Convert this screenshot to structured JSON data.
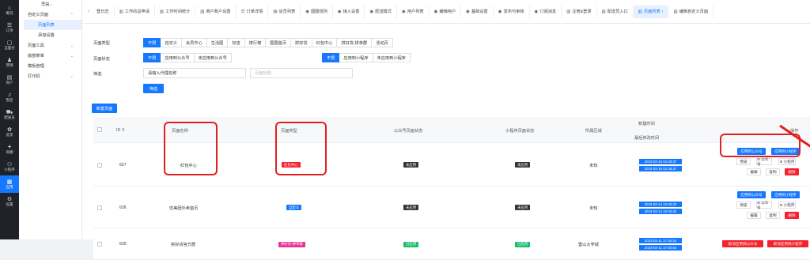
{
  "rail": [
    {
      "icon": "⌂",
      "label": "概况"
    },
    {
      "icon": "☰",
      "label": "订单"
    },
    {
      "icon": "▢",
      "label": "当面付"
    },
    {
      "icon": "♟",
      "label": "营销"
    },
    {
      "icon": "▤",
      "label": "商户"
    },
    {
      "icon": "♫",
      "label": "售后"
    },
    {
      "icon": "⛟",
      "label": "配送员"
    },
    {
      "icon": "✿",
      "label": "选货"
    },
    {
      "icon": "✦",
      "label": "商圈"
    },
    {
      "icon": "⚇",
      "label": "小程序"
    },
    {
      "icon": "▦",
      "label": "应用"
    },
    {
      "icon": "⚙",
      "label": "设置"
    }
  ],
  "submenu": {
    "top": "早由...",
    "items": [
      {
        "label": "自定义页面",
        "type": "group",
        "chev": "⌃"
      },
      {
        "label": "页面列表",
        "type": "item",
        "active": true
      },
      {
        "label": "添加设置",
        "type": "item",
        "active": false
      },
      {
        "label": "页面工具",
        "type": "group",
        "chev": "⌄"
      },
      {
        "label": "底部菜单",
        "type": "group",
        "chev": "⌄"
      },
      {
        "label": "模板管理",
        "type": "leaf"
      },
      {
        "label": "打印机",
        "type": "group",
        "chev": "⌄"
      }
    ]
  },
  "tabs": [
    {
      "icon": "",
      "label": "登日志",
      "active": false
    },
    {
      "icon": "▥",
      "label": "工作的总申请",
      "active": false
    },
    {
      "icon": "▥",
      "label": "工作时间统计",
      "active": false
    },
    {
      "icon": "▥",
      "label": "商户账户设置",
      "active": false
    },
    {
      "icon": "☰",
      "label": "订单详情",
      "active": false
    },
    {
      "icon": "▤",
      "label": "店员列表",
      "active": false
    },
    {
      "icon": "◉",
      "label": "圆圈规则",
      "active": false
    },
    {
      "icon": "◉",
      "label": "接入设置",
      "active": false
    },
    {
      "icon": "◉",
      "label": "配送模式",
      "active": false
    },
    {
      "icon": "◉",
      "label": "用户列表",
      "active": false
    },
    {
      "icon": "◉",
      "label": "编辑用户",
      "active": false
    },
    {
      "icon": "◉",
      "label": "基础设置",
      "active": false
    },
    {
      "icon": "◉",
      "label": "发布与审核",
      "active": false
    },
    {
      "icon": "◉",
      "label": "订阅消息",
      "active": false
    },
    {
      "icon": "▥",
      "label": "注册&登录",
      "active": false
    },
    {
      "icon": "▥",
      "label": "配送员入口",
      "active": false
    },
    {
      "icon": "▥",
      "label": "页面列表",
      "active": true
    },
    {
      "icon": "▥",
      "label": "编辑自定义页面",
      "active": false
    }
  ],
  "filters": {
    "type_label": "页面类型",
    "type_chips": [
      "不限",
      "自定义",
      "会员中心",
      "生活圈",
      "好店",
      "排行榜",
      "圈圈首页",
      "拼好货",
      "红包中心",
      "拼好货-拼单群",
      "活动页"
    ],
    "status_label": "页面状态",
    "status_chips_mp": [
      "不限",
      "应用到公众号",
      "未应用到公众号"
    ],
    "status_chips_app": [
      "不限",
      "应用到小程序",
      "未应用到小程序"
    ],
    "search_label": "筛选",
    "agent_input": "请输入代理名称",
    "title_placeholder": "页面标题",
    "filter_button": "筛选",
    "new_button": "新建页面"
  },
  "table": {
    "headers": {
      "id": "ID ⇕",
      "name": "页面名称",
      "type": "页面类型",
      "mp_status": "公众号页面状态",
      "app_status": "小程序页面状态",
      "region": "所属区域",
      "created": "新建时间",
      "updated": "最后修改时间",
      "ops": "操作"
    },
    "rows": [
      {
        "id": "627",
        "name": "红包中心",
        "type": "红包中心",
        "type_color": "red",
        "mp_status": "未应用",
        "mp_color": "dark",
        "app_status": "未应用",
        "app_color": "dark",
        "region": "未知",
        "created": "2023-03-15 01:48:37",
        "updated": "2023-03-15 01:48:37",
        "ops_top": [
          "应用到公众号",
          "应用到小程序"
        ],
        "ops_mid": [
          "预览",
          "⊘ 公众号",
          "⊘ 小程序"
        ],
        "ops_bot": [
          "编辑",
          "复制",
          "删除"
        ]
      },
      {
        "id": "626",
        "name": "仿美团外卖首页",
        "type": "自定义",
        "type_color": "blue",
        "mp_status": "未应用",
        "mp_color": "dark",
        "app_status": "未应用",
        "app_color": "dark",
        "region": "未知",
        "created": "2023-03-14 10:40:32",
        "updated": "2023-03-14 10:40:32",
        "ops_top": [
          "应用到公众号",
          "应用到小程序"
        ],
        "ops_mid": [
          "预览",
          "⊘ 公众号",
          "⊘ 小程序"
        ],
        "ops_bot": [
          "编辑",
          "复制",
          "删除"
        ]
      },
      {
        "id": "625",
        "name": "拼好货官方群",
        "type": "拼好货-拼单群",
        "type_color": "mag",
        "mp_status": "已应用",
        "mp_color": "green",
        "app_status": "已应用",
        "app_color": "green",
        "region": "暨山大学城",
        "created": "2023-03-11 17:46:24",
        "updated": "2023-03-11 17:50:53",
        "ops_top": [
          "取消应用到公众号",
          "取消应用到小程序"
        ],
        "ops_mid": [],
        "ops_bot": []
      }
    ]
  },
  "colors": {
    "accent": "#1677ff",
    "highlight": "#e02020",
    "sidebar": "#1f2329"
  }
}
